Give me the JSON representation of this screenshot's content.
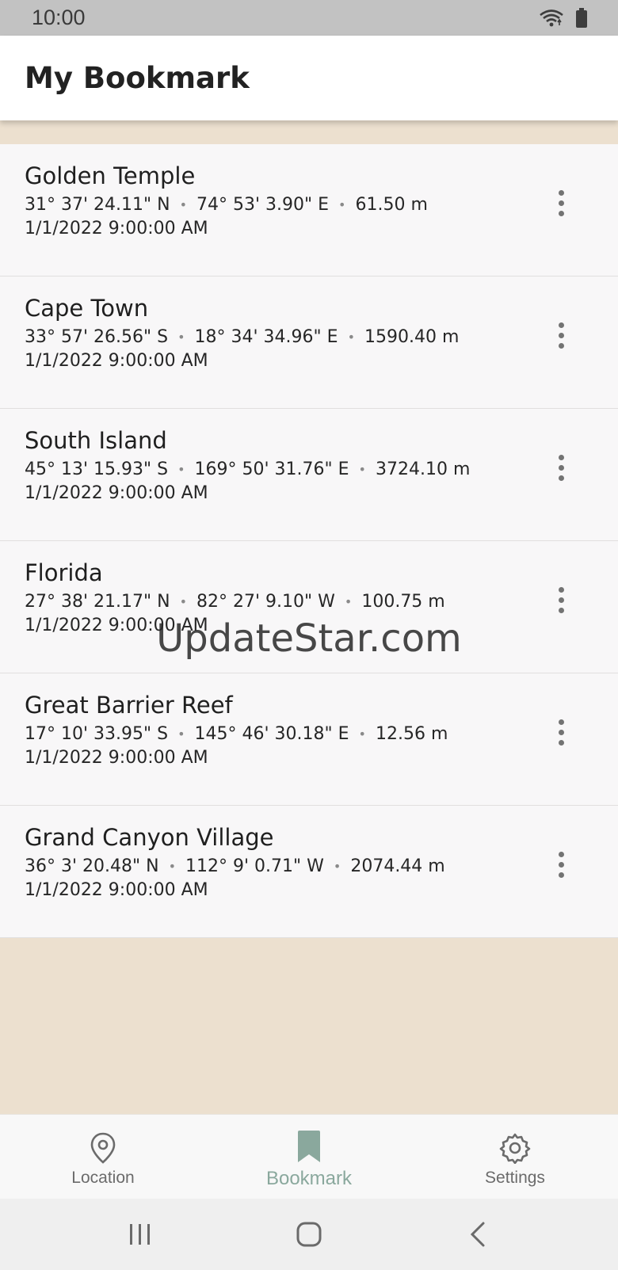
{
  "status_bar": {
    "time": "10:00",
    "icons": [
      "wifi-icon",
      "battery-icon"
    ]
  },
  "app_bar": {
    "title": "My Bookmark"
  },
  "bookmarks": [
    {
      "name": "Golden Temple",
      "lat": "31° 37' 24.11\" N",
      "lon": "74° 53' 3.90\" E",
      "alt": "61.50 m",
      "date": "1/1/2022 9:00:00 AM"
    },
    {
      "name": "Cape Town",
      "lat": "33° 57' 26.56\" S",
      "lon": "18° 34' 34.96\" E",
      "alt": "1590.40 m",
      "date": "1/1/2022 9:00:00 AM"
    },
    {
      "name": "South Island",
      "lat": "45° 13' 15.93\" S",
      "lon": "169° 50' 31.76\" E",
      "alt": "3724.10 m",
      "date": "1/1/2022 9:00:00 AM"
    },
    {
      "name": "Florida",
      "lat": "27° 38' 21.17\" N",
      "lon": "82° 27' 9.10\" W",
      "alt": "100.75 m",
      "date": "1/1/2022 9:00:00 AM"
    },
    {
      "name": "Great Barrier Reef",
      "lat": "17° 10' 33.95\" S",
      "lon": "145° 46' 30.18\" E",
      "alt": "12.56 m",
      "date": "1/1/2022 9:00:00 AM"
    },
    {
      "name": "Grand Canyon Village",
      "lat": "36° 3' 20.48\" N",
      "lon": "112° 9' 0.71\" W",
      "alt": "2074.44 m",
      "date": "1/1/2022 9:00:00 AM"
    }
  ],
  "watermark": "UpdateStar.com",
  "bottom_nav": {
    "items": [
      {
        "label": "Location",
        "icon": "location-pin-icon",
        "active": false
      },
      {
        "label": "Bookmark",
        "icon": "bookmark-icon",
        "active": true
      },
      {
        "label": "Settings",
        "icon": "gear-icon",
        "active": false
      }
    ]
  },
  "system_nav": [
    "recent-apps-icon",
    "home-icon",
    "back-icon"
  ],
  "colors": {
    "background": "#ece0cf",
    "accent": "#8aa89d",
    "list_bg": "#f8f7f8"
  }
}
